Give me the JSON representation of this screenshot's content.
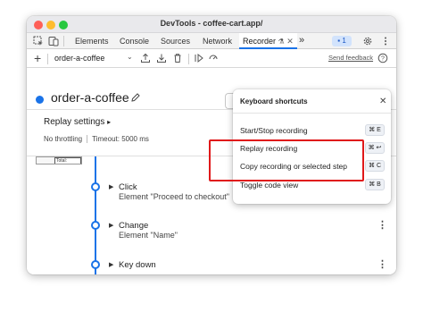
{
  "window": {
    "title": "DevTools - coffee-cart.app/"
  },
  "tabs": [
    {
      "label": "Elements"
    },
    {
      "label": "Console"
    },
    {
      "label": "Sources"
    },
    {
      "label": "Network"
    },
    {
      "label": "Recorder"
    }
  ],
  "tab_overflow": "»",
  "issues_count": "1",
  "toolbar": {
    "recording_select": "order-a-coffee",
    "send_feedback": "Send feedback"
  },
  "recording": {
    "name": "order-a-coffee"
  },
  "replay": {
    "title": "Replay settings",
    "throttling": "No throttling",
    "timeout": "Timeout: 5000 ms"
  },
  "thumbnail": {
    "text": "Total: $20.00"
  },
  "steps": [
    {
      "title": "Click",
      "subtitle": "Element \"Proceed to checkout\""
    },
    {
      "title": "Change",
      "subtitle": "Element \"Name\""
    },
    {
      "title": "Key down",
      "subtitle": ""
    }
  ],
  "shortcuts": {
    "title": "Keyboard shortcuts",
    "items": [
      {
        "label": "Start/Stop recording",
        "keys": "⌘ E"
      },
      {
        "label": "Replay recording",
        "keys": "⌘ ↩"
      },
      {
        "label": "Copy recording or selected step",
        "keys": "⌘ C"
      },
      {
        "label": "Toggle code view",
        "keys": "⌘ B"
      }
    ]
  },
  "colors": {
    "accent": "#1a73e8",
    "highlight": "#e0191a"
  }
}
